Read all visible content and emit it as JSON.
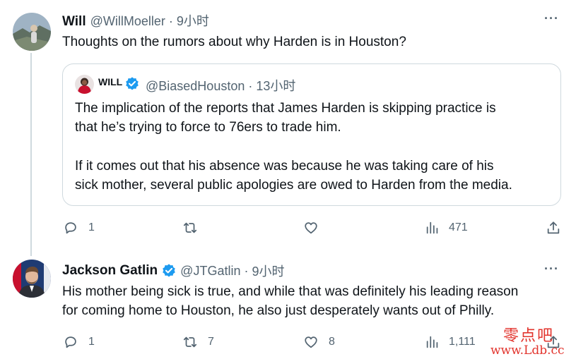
{
  "tweet1": {
    "name": "Will",
    "handle": "@WillMoeller",
    "dot": "·",
    "time": "9小时",
    "more": "···",
    "text": "Thoughts on the rumors about why Harden is in Houston?",
    "icons": [
      "avatar-photo",
      "more-icon"
    ]
  },
  "quote": {
    "name": "WILL",
    "handle": "@BiasedHouston",
    "dot": "·",
    "time": "13小时",
    "para1_line1": "The implication of the reports that James Harden is skipping practice is",
    "para1_line2": "that he’s trying to force to 76ers to trade him.",
    "para2_line1": "If it comes out that his absence was because he was taking care of his",
    "para2_line2": "sick mother, several public apologies are owed to Harden from the media."
  },
  "actions1": {
    "reply_count": "1",
    "retweet_count": "",
    "like_count": "",
    "view_count": "471"
  },
  "tweet2": {
    "name": "Jackson Gatlin",
    "handle": "@JTGatlin",
    "dot": "·",
    "time": "9小时",
    "more": "···",
    "line1": "His mother being sick is true, and while that was definitely his leading reason",
    "line2": "for coming home to Houston, he also just desperately wants out of Philly."
  },
  "actions2": {
    "reply_count": "1",
    "retweet_count": "7",
    "like_count": "8",
    "view_count": "1,111"
  },
  "watermark": {
    "line1": "零点吧",
    "line2": "www.Ldb.cc"
  },
  "colors": {
    "verified": "#1d9bf0",
    "muted": "#536471",
    "border": "#cfd9de",
    "watermark": "#e2342d"
  }
}
